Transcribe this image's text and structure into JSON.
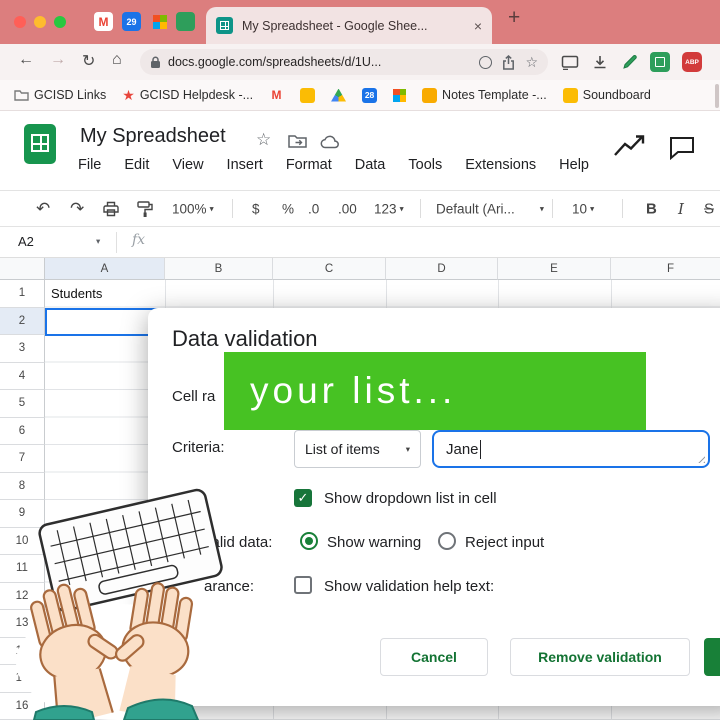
{
  "icons": {
    "close_tab": "×",
    "new_tab": "+",
    "back": "←",
    "forward": "→",
    "reload": "↻",
    "home": "⌂",
    "caret_down": "▾",
    "star_outline": "☆",
    "star_filled": "★",
    "check": "✓",
    "undo": "↶",
    "redo": "↷"
  },
  "tabstrip": {
    "gmail_letter": "M",
    "calendar_number": "29",
    "tab_title": "My Spreadsheet - Google Shee..."
  },
  "address": {
    "url": "docs.google.com/spreadsheets/d/1U...",
    "abp_label": "ABP"
  },
  "bookmarks": {
    "links": "GCISD Links",
    "helpdesk": "GCISD Helpdesk -...",
    "gmail_letter": "M",
    "calendar_number": "28",
    "notes": "Notes Template -...",
    "soundboard": "Soundboard"
  },
  "sheets": {
    "title": "My Spreadsheet",
    "menus": [
      "File",
      "Edit",
      "View",
      "Insert",
      "Format",
      "Data",
      "Tools",
      "Extensions",
      "Help"
    ],
    "toolbar": {
      "zoom": "100%",
      "currency": "$",
      "percent": "%",
      "decimal_decrease": ".0",
      "decimal_increase": ".00",
      "more_formats": "123",
      "font_name": "Default (Ari...",
      "font_size": "10",
      "bold": "B",
      "italic": "I",
      "strikethrough": "S"
    },
    "name_box": "A2",
    "formula_fx": "fx"
  },
  "grid": {
    "columns": [
      "A",
      "B",
      "C",
      "D",
      "E",
      "F"
    ],
    "rows": [
      "1",
      "2",
      "3",
      "4",
      "5",
      "6",
      "7",
      "8",
      "9",
      "10",
      "11",
      "12",
      "13",
      "14",
      "15",
      "16"
    ],
    "cell_a1": "Students"
  },
  "banner": {
    "text": "your list..."
  },
  "dialog": {
    "title": "Data validation",
    "cell_range_label": "Cell ra",
    "criteria_label": "Criteria:",
    "criteria_value": "List of items",
    "items_value": "Jane",
    "show_dropdown_label": "Show dropdown list in cell",
    "invalid_data_label": "valid data:",
    "show_warning_label": "Show warning",
    "reject_input_label": "Reject input",
    "appearance_label": "arance:",
    "help_text_label": "Show validation help text:",
    "cancel_label": "Cancel",
    "remove_label": "Remove validation"
  }
}
